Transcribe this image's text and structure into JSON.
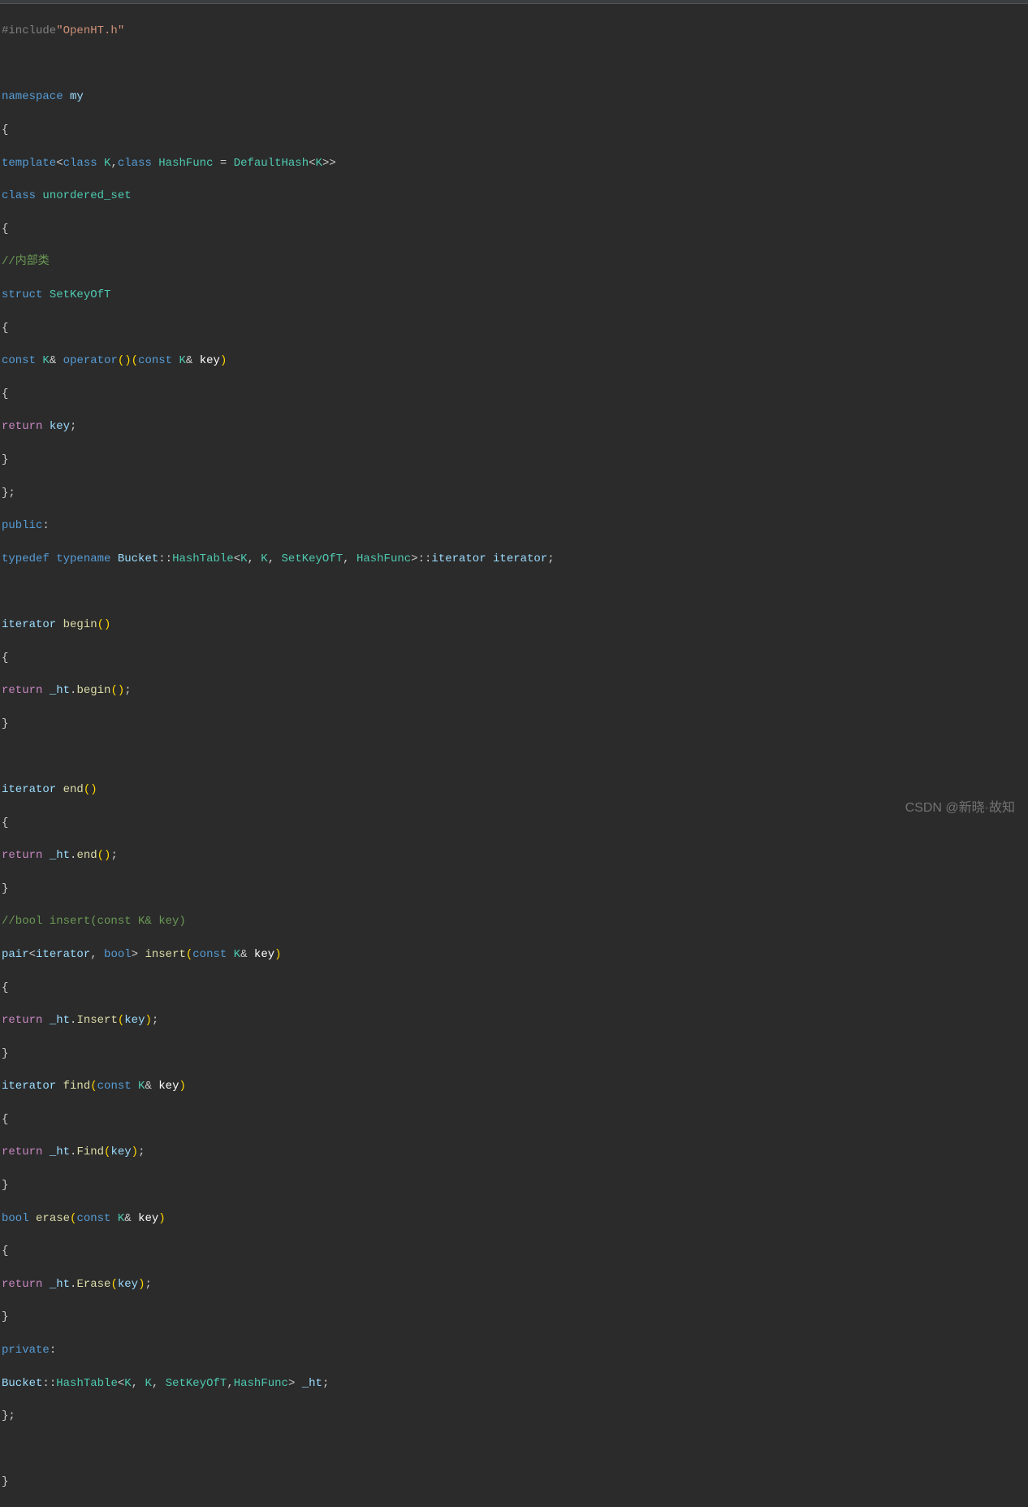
{
  "watermark": "CSDN @新晓·故知",
  "code": {
    "l1_include": "#include",
    "l1_str": "\"OpenHT.h\"",
    "l3_namespace": "namespace",
    "l3_my": " my",
    "l5_template": "template",
    "l5_class1": "class",
    "l5_K": " K",
    "l5_class2": "class",
    "l5_HashFunc": " HashFunc ",
    "l5_DefaultHash": " DefaultHash",
    "l5_K2": "K",
    "l6_class": "class",
    "l6_unordered_set": " unordered_set",
    "l8_comment": "//内部类",
    "l9_struct": "struct",
    "l9_SetKeyOfT": " SetKeyOfT",
    "l11_const": "const",
    "l11_K": " K",
    "l11_amp": "& ",
    "l11_operator": "operator",
    "l11_const2": "const",
    "l11_K2": " K",
    "l11_amp2": "& ",
    "l11_key": "key",
    "l13_return": "return",
    "l13_key": " key",
    "l16_public": "public",
    "l17_typedef": "typedef",
    "l17_typename": " typename",
    "l17_Bucket": " Bucket",
    "l17_HashTable": "HashTable",
    "l17_K": "K",
    "l17_K2": " K",
    "l17_SetKeyOfT": " SetKeyOfT",
    "l17_HashFunc": " HashFunc",
    "l17_iterator": "iterator",
    "l17_iterator2": " iterator",
    "l19_iterator": "iterator",
    "l19_begin": " begin",
    "l21_return": "return",
    "l21_ht": " _ht",
    "l21_begin": "begin",
    "l24_iterator": "iterator",
    "l24_end": " end",
    "l26_return": "return",
    "l26_ht": " _ht",
    "l26_end": "end",
    "l28_comment": "//bool insert(const K& key)",
    "l29_pair": "pair",
    "l29_iterator": "iterator",
    "l29_bool": " bool",
    "l29_insert": " insert",
    "l29_const": "const",
    "l29_K": " K",
    "l29_amp": "& ",
    "l29_key": "key",
    "l31_return": "return",
    "l31_ht": " _ht",
    "l31_Insert": "Insert",
    "l31_key": "key",
    "l33_iterator": "iterator",
    "l33_find": " find",
    "l33_const": "const",
    "l33_K": " K",
    "l33_amp": "& ",
    "l33_key": "key",
    "l35_return": "return",
    "l35_ht": " _ht",
    "l35_Find": "Find",
    "l35_key": "key",
    "l37_bool": "bool",
    "l37_erase": " erase",
    "l37_const": "const",
    "l37_K": " K",
    "l37_amp": "& ",
    "l37_key": "key",
    "l39_return": "return",
    "l39_ht": " _ht",
    "l39_Erase": "Erase",
    "l39_key": "key",
    "l41_private": "private",
    "l42_Bucket": "Bucket",
    "l42_HashTable": "HashTable",
    "l42_K": "K",
    "l42_K2": " K",
    "l42_SetKeyOfT": " SetKeyOfT",
    "l42_HashFunc": "HashFunc",
    "l42_ht": " _ht"
  }
}
